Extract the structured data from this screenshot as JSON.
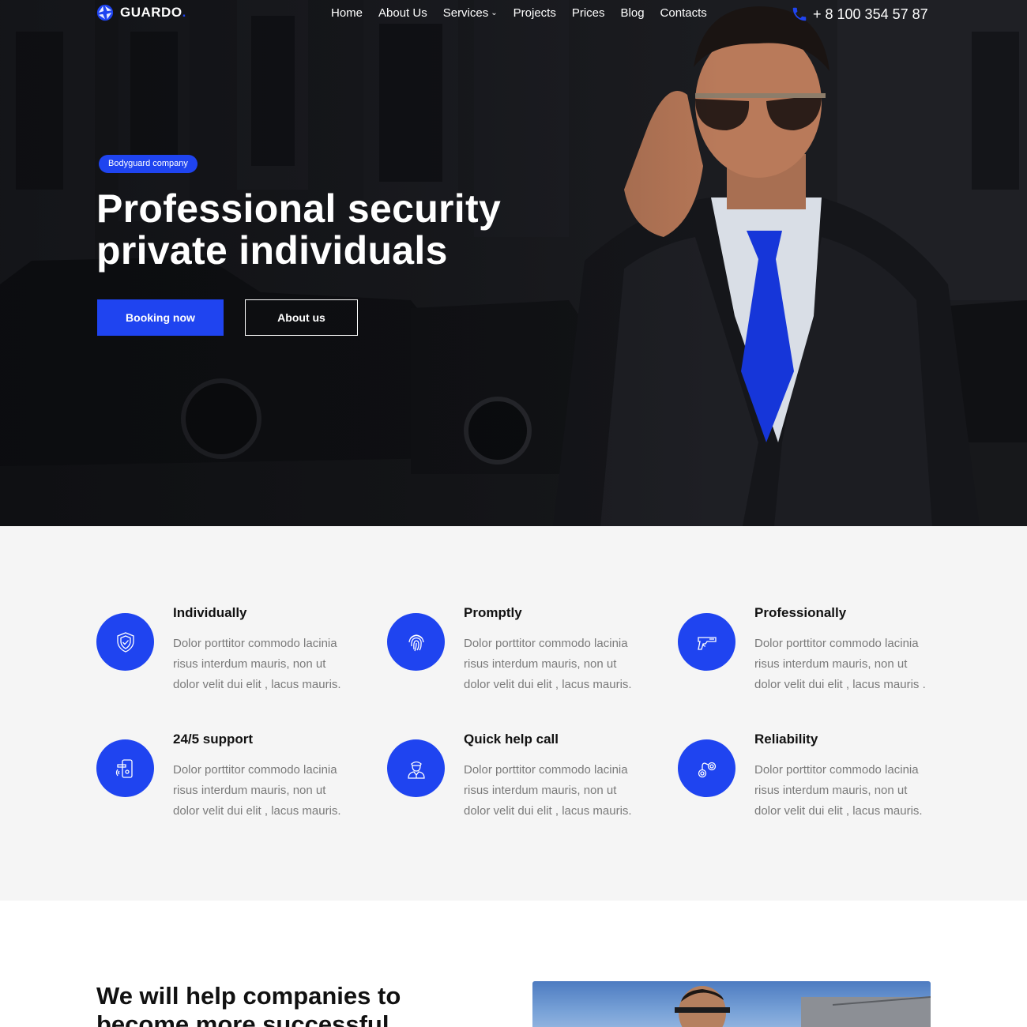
{
  "brand": {
    "name": "GUARDO",
    "dot": ".",
    "accent": "#1f44f0"
  },
  "nav": {
    "items": [
      {
        "label": "Home"
      },
      {
        "label": "About Us"
      },
      {
        "label": "Services",
        "dropdown": true
      },
      {
        "label": "Projects"
      },
      {
        "label": "Prices"
      },
      {
        "label": "Blog"
      },
      {
        "label": "Contacts"
      }
    ],
    "phone": "+ 8 100 354 57 87"
  },
  "hero": {
    "badge": "Bodyguard company",
    "title_line1": "Professional security",
    "title_line2": "private individuals",
    "primary_button": "Booking now",
    "secondary_button": "About us"
  },
  "features": [
    {
      "title": "Individually",
      "text": "Dolor porttitor commodo lacinia risus interdum mauris, non ut dolor velit dui elit , lacus mauris.",
      "icon": "shield-icon"
    },
    {
      "title": "Promptly",
      "text": "Dolor porttitor commodo lacinia risus interdum mauris, non ut dolor velit dui elit , lacus mauris.",
      "icon": "fingerprint-icon"
    },
    {
      "title": "Professionally",
      "text": "Dolor porttitor commodo lacinia risus interdum mauris, non ut dolor velit dui elit , lacus mauris .",
      "icon": "pistol-icon"
    },
    {
      "title": "24/5 support",
      "text": "Dolor porttitor commodo lacinia risus interdum mauris, non ut dolor velit dui elit , lacus mauris.",
      "icon": "door-lock-icon"
    },
    {
      "title": "Quick help call",
      "text": "Dolor porttitor commodo lacinia risus interdum mauris, non ut dolor velit dui elit , lacus mauris.",
      "icon": "guard-icon"
    },
    {
      "title": "Reliability",
      "text": "Dolor porttitor commodo lacinia risus interdum mauris, non ut dolor velit dui elit , lacus mauris.",
      "icon": "handcuffs-icon"
    }
  ],
  "section": {
    "title": "We will help companies to become more successful"
  }
}
